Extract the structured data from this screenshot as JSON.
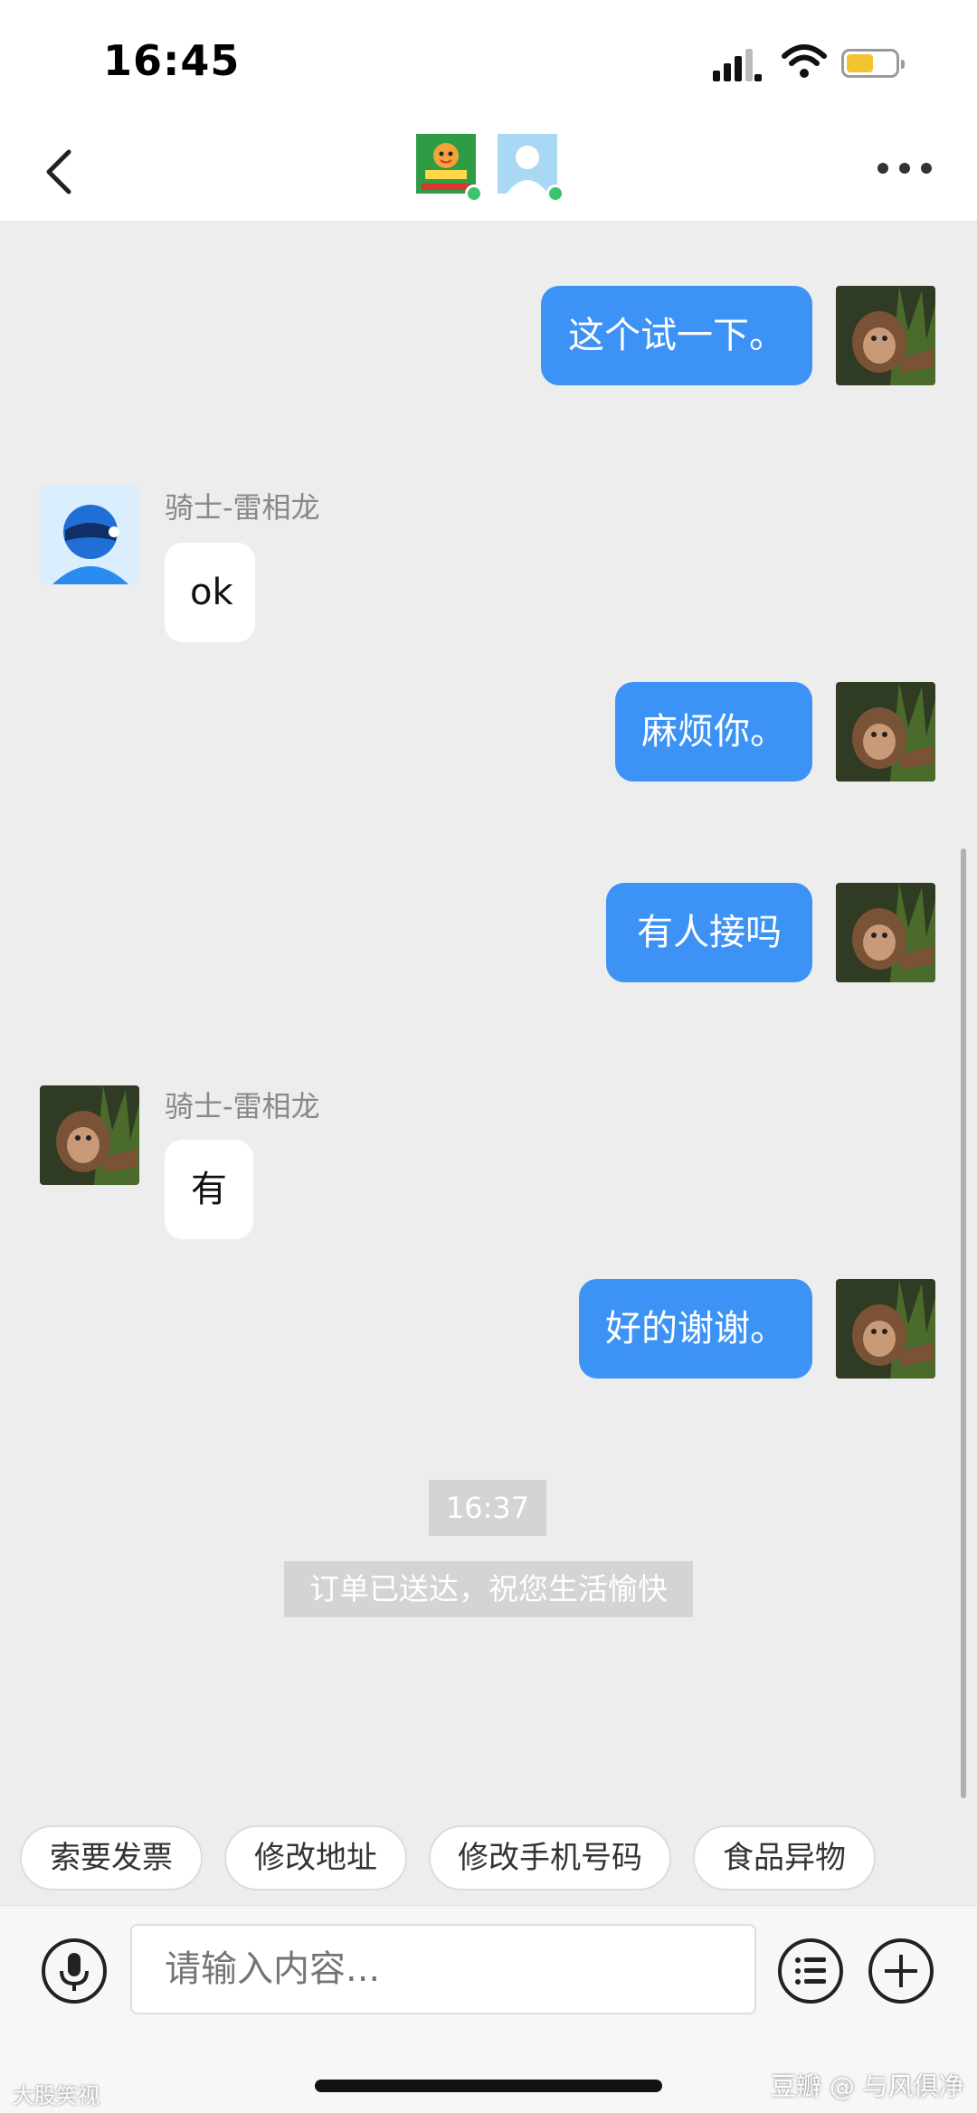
{
  "status_bar": {
    "time": "16:45",
    "battery_level": 0.55
  },
  "header": {
    "icons": {
      "back": "chevron-left-icon",
      "more": "more-dots-icon"
    },
    "participants": [
      "merchant-avatar",
      "user-avatar"
    ],
    "online_color": "#3cc46d"
  },
  "messages": [
    {
      "direction": "out",
      "text": "这个试一下。"
    },
    {
      "direction": "in",
      "sender": "骑士-雷相龙",
      "text": "ok"
    },
    {
      "direction": "out",
      "text": "麻烦你。"
    },
    {
      "direction": "out",
      "text": "有人接吗"
    },
    {
      "direction": "in",
      "sender": "骑士-雷相龙",
      "text": "有"
    },
    {
      "direction": "out",
      "text": "好的谢谢。"
    }
  ],
  "system": {
    "time": "16:37",
    "notice": "订单已送达，祝您生活愉快"
  },
  "quick_replies": [
    "索要发票",
    "修改地址",
    "修改手机号码",
    "食品异物"
  ],
  "input": {
    "placeholder": "请输入内容..."
  },
  "watermarks": {
    "left": "大股笑视",
    "right": "豆瓣 @ 与风俱净"
  },
  "colors": {
    "outgoing_bubble": "#3d93f5",
    "incoming_bubble": "#ffffff",
    "chat_background": "#ededed"
  }
}
